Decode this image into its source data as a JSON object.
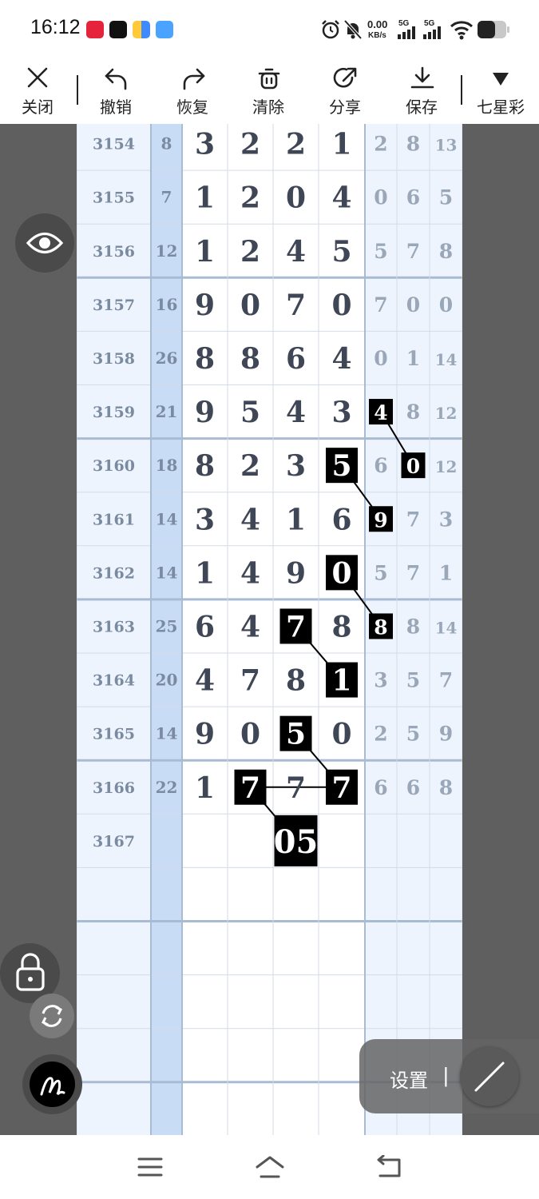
{
  "status_bar": {
    "time": "16:12",
    "net_speed_value": "0.00",
    "net_speed_unit": "KB/s",
    "sig1": "5G",
    "sig2": "5G"
  },
  "toolbar": {
    "close_label": "关闭",
    "undo_label": "撤销",
    "redo_label": "恢复",
    "clear_label": "清除",
    "share_label": "分享",
    "save_label": "保存",
    "lottery_label": "七星彩"
  },
  "table": {
    "rows": [
      {
        "issue": "3154",
        "sum": "8",
        "d": [
          "3",
          "2",
          "2",
          "1"
        ],
        "t": [
          "2",
          "8",
          "13"
        ]
      },
      {
        "issue": "3155",
        "sum": "7",
        "d": [
          "1",
          "2",
          "0",
          "4"
        ],
        "t": [
          "0",
          "6",
          "5"
        ]
      },
      {
        "issue": "3156",
        "sum": "12",
        "d": [
          "1",
          "2",
          "4",
          "5"
        ],
        "t": [
          "5",
          "7",
          "8"
        ]
      },
      {
        "issue": "3157",
        "sum": "16",
        "d": [
          "9",
          "0",
          "7",
          "0"
        ],
        "t": [
          "7",
          "0",
          "0"
        ]
      },
      {
        "issue": "3158",
        "sum": "26",
        "d": [
          "8",
          "8",
          "6",
          "4"
        ],
        "t": [
          "0",
          "1",
          "14"
        ]
      },
      {
        "issue": "3159",
        "sum": "21",
        "d": [
          "9",
          "5",
          "4",
          "3"
        ],
        "t": [
          "4",
          "8",
          "12"
        ]
      },
      {
        "issue": "3160",
        "sum": "18",
        "d": [
          "8",
          "2",
          "3",
          "5"
        ],
        "t": [
          "6",
          "0",
          "12"
        ]
      },
      {
        "issue": "3161",
        "sum": "14",
        "d": [
          "3",
          "4",
          "1",
          "6"
        ],
        "t": [
          "9",
          "7",
          "3"
        ]
      },
      {
        "issue": "3162",
        "sum": "14",
        "d": [
          "1",
          "4",
          "9",
          "0"
        ],
        "t": [
          "5",
          "7",
          "1"
        ]
      },
      {
        "issue": "3163",
        "sum": "25",
        "d": [
          "6",
          "4",
          "7",
          "8"
        ],
        "t": [
          "8",
          "8",
          "14"
        ]
      },
      {
        "issue": "3164",
        "sum": "20",
        "d": [
          "4",
          "7",
          "8",
          "1"
        ],
        "t": [
          "3",
          "5",
          "7"
        ]
      },
      {
        "issue": "3165",
        "sum": "14",
        "d": [
          "9",
          "0",
          "5",
          "0"
        ],
        "t": [
          "2",
          "5",
          "9"
        ]
      },
      {
        "issue": "3166",
        "sum": "22",
        "d": [
          "1",
          "7",
          "7",
          "7"
        ],
        "t": [
          "6",
          "6",
          "8"
        ]
      },
      {
        "issue": "3167",
        "sum": "",
        "d": [
          "",
          "",
          "",
          ""
        ],
        "t": [
          "",
          "",
          ""
        ]
      }
    ],
    "marked": [
      {
        "row": 5,
        "col": "t0"
      },
      {
        "row": 6,
        "col": "d3"
      },
      {
        "row": 6,
        "col": "t1"
      },
      {
        "row": 7,
        "col": "t0"
      },
      {
        "row": 8,
        "col": "d3"
      },
      {
        "row": 9,
        "col": "t0"
      },
      {
        "row": 9,
        "col": "d2"
      },
      {
        "row": 10,
        "col": "d3"
      },
      {
        "row": 11,
        "col": "d2"
      },
      {
        "row": 12,
        "col": "d3"
      },
      {
        "row": 12,
        "col": "d1"
      }
    ],
    "prediction": {
      "row": 13,
      "value": "05"
    }
  },
  "controls": {
    "settings_label": "设置",
    "settings_divider": "|"
  },
  "colors": {
    "digit": "#3f4656",
    "tail": "#9aa7b8",
    "issue": "#7a8aa0",
    "sum_col_bg": "#c9dcf5",
    "row_bg": "#eef4fd",
    "mark_bg": "#000000",
    "mark_fg": "#ffffff"
  },
  "icons": {
    "close": "close-icon",
    "undo": "undo-icon",
    "redo": "redo-icon",
    "clear": "trash-icon",
    "share": "share-icon",
    "save": "download-icon",
    "dropdown": "triangle-down-icon",
    "eye": "eye-icon",
    "lock": "lock-icon",
    "rotate": "rotate-icon",
    "pen": "pen-icon",
    "line": "line-tool-icon"
  }
}
